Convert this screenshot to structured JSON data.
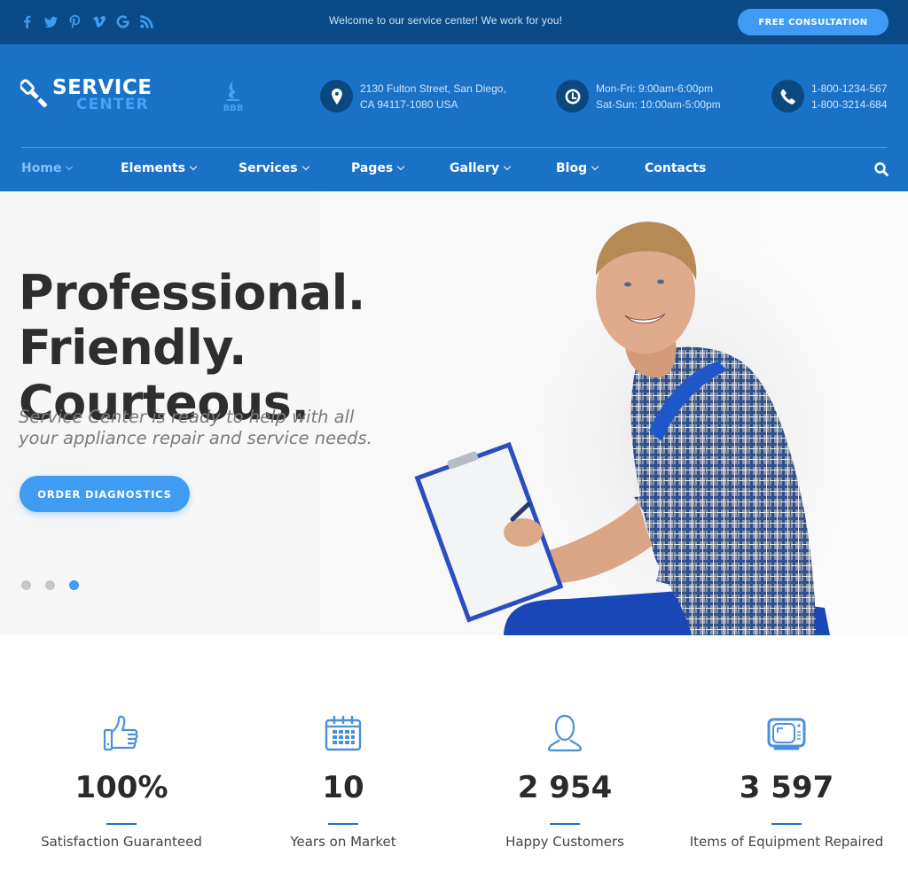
{
  "topbar": {
    "socials": [
      {
        "name": "facebook-icon",
        "glyph": "f"
      },
      {
        "name": "twitter-icon",
        "glyph": ""
      },
      {
        "name": "pinterest-icon",
        "glyph": "P"
      },
      {
        "name": "vimeo-icon",
        "glyph": "V"
      },
      {
        "name": "google-icon",
        "glyph": "G"
      },
      {
        "name": "rss-icon",
        "glyph": ""
      }
    ],
    "welcome": "Welcome to our service center! We work for you!",
    "cta_label": "FREE CONSULTATION"
  },
  "header": {
    "logo": {
      "line1": "SERVICE",
      "line2": "CENTER"
    },
    "bbb_label": "BBB",
    "address": {
      "line1": "2130 Fulton Street, San Diego,",
      "line2": "CA 94117-1080 USA"
    },
    "hours": {
      "line1": "Mon-Fri: 9:00am-6:00pm",
      "line2": "Sat-Sun: 10:00am-5:00pm"
    },
    "phones": {
      "line1": "1-800-1234-567",
      "line2": "1-800-3214-684"
    }
  },
  "nav": {
    "items": [
      {
        "label": "Home",
        "dropdown": true,
        "active": true
      },
      {
        "label": "Elements",
        "dropdown": true
      },
      {
        "label": "Services",
        "dropdown": true
      },
      {
        "label": "Pages",
        "dropdown": true
      },
      {
        "label": "Gallery",
        "dropdown": true
      },
      {
        "label": "Blog",
        "dropdown": true
      },
      {
        "label": "Contacts",
        "dropdown": false
      }
    ]
  },
  "hero": {
    "title_line1": "Professional. Friendly.",
    "title_line2": "Courteous.",
    "subtitle": "Service Center is ready to help with all your appliance repair and service needs.",
    "button_label": "ORDER DIAGNOSTICS",
    "slides_total": 3,
    "active_slide": 3
  },
  "stats": [
    {
      "icon": "thumbs-up-icon",
      "value": "100%",
      "label": "Satisfaction Guaranteed"
    },
    {
      "icon": "calendar-icon",
      "value": "10",
      "label": "Years on Market"
    },
    {
      "icon": "user-icon",
      "value": "2 954",
      "label": "Happy Customers"
    },
    {
      "icon": "tv-icon",
      "value": "3 597",
      "label": "Items of Equipment Repaired"
    }
  ],
  "colors": {
    "topbar_bg": "#0a4a86",
    "header_bg": "#1a72c7",
    "accent": "#3f9cf2",
    "icon_circle": "#0c4880",
    "heading": "#2e2e2e"
  }
}
